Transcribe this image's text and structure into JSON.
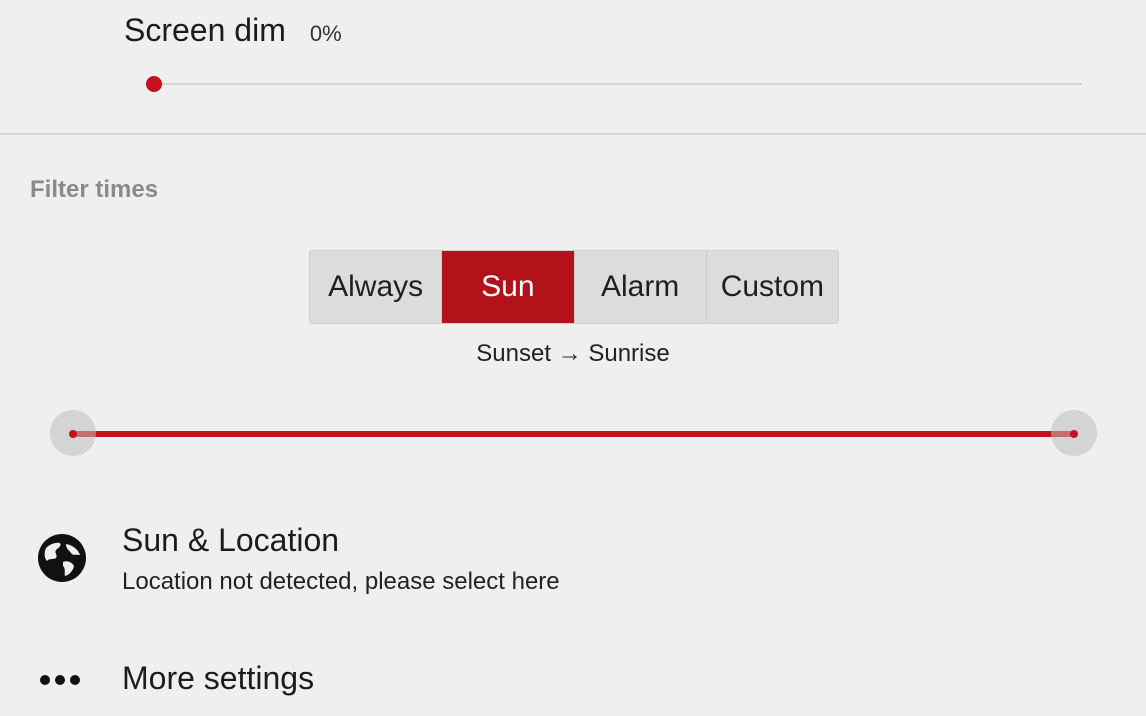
{
  "screen_dim": {
    "label": "Screen dim",
    "value": "0%",
    "slider_level_percent": 0
  },
  "filter_times": {
    "header": "Filter times",
    "segments": [
      {
        "label": "Always",
        "selected": false
      },
      {
        "label": "Sun",
        "selected": true
      },
      {
        "label": "Alarm",
        "selected": false
      },
      {
        "label": "Custom",
        "selected": false
      }
    ],
    "range_text": "Sunset → Sunrise"
  },
  "sun_location": {
    "title": "Sun & Location",
    "subtitle": "Location not detected, please select here",
    "icon": "globe-icon"
  },
  "more_settings": {
    "title": "More settings",
    "icon": "more-dots-icon"
  },
  "colors": {
    "accent": "#c4111a",
    "accent_selected": "#b3121a",
    "background": "#efefef",
    "section_header": "#8a8a8a"
  }
}
